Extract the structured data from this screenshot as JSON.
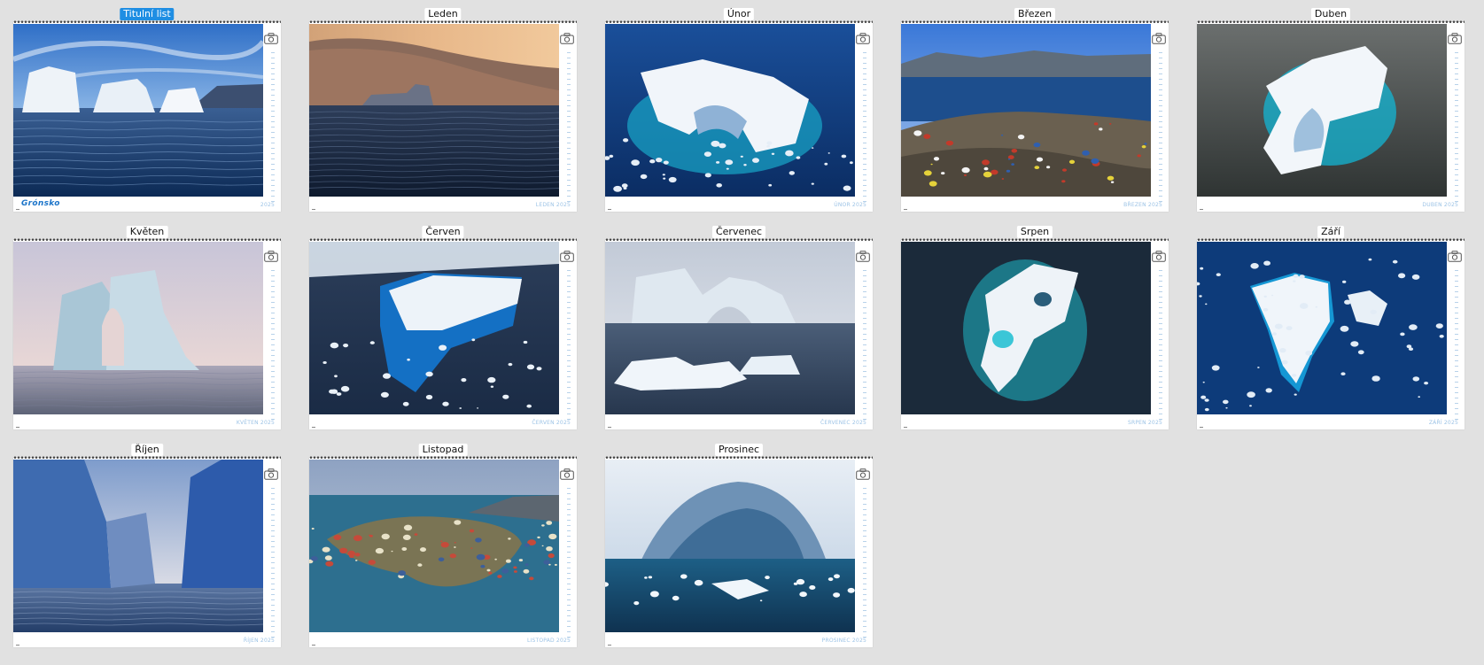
{
  "colors": {
    "background": "#e1e1e1",
    "selected_tag": "#1f8ee3",
    "footer_text": "#9cc3e6",
    "cover_title": "#1b74c9"
  },
  "pages": [
    {
      "label": "Titulní list",
      "footer": "2025",
      "cover_title": "Grónsko",
      "selected": true,
      "scene": "icebergs-sunny",
      "icon": "camera-icon"
    },
    {
      "label": "Leden",
      "footer": "LEDEN 2025",
      "selected": false,
      "scene": "dusk-sea",
      "icon": "camera-icon"
    },
    {
      "label": "Únor",
      "footer": "ÚNOR 2025",
      "selected": false,
      "scene": "aerial-arch",
      "icon": "camera-icon"
    },
    {
      "label": "Březen",
      "footer": "BŘEZEN 2025",
      "selected": false,
      "scene": "village-fjord",
      "icon": "camera-icon"
    },
    {
      "label": "Duben",
      "footer": "DUBEN 2025",
      "selected": false,
      "scene": "aerial-dark",
      "icon": "camera-icon"
    },
    {
      "label": "Květen",
      "footer": "KVĚTEN 2025",
      "selected": false,
      "scene": "arch-pastel",
      "icon": "camera-icon"
    },
    {
      "label": "Červen",
      "footer": "ČERVEN 2025",
      "selected": false,
      "scene": "floes-blue",
      "icon": "camera-icon"
    },
    {
      "label": "Červenec",
      "footer": "ČERVENEC 2025",
      "selected": false,
      "scene": "arch-grey",
      "icon": "camera-icon"
    },
    {
      "label": "Srpen",
      "footer": "SRPEN 2025",
      "selected": false,
      "scene": "aerial-night",
      "icon": "camera-icon"
    },
    {
      "label": "Září",
      "footer": "ZÁŘÍ 2025",
      "selected": false,
      "scene": "aerial-floes",
      "icon": "camera-icon"
    },
    {
      "label": "Říjen",
      "footer": "ŘÍJEN 2025",
      "selected": false,
      "scene": "walls-blue",
      "icon": "camera-icon"
    },
    {
      "label": "Listopad",
      "footer": "LISTOPAD 2025",
      "selected": false,
      "scene": "town-aerial",
      "icon": "camera-icon"
    },
    {
      "label": "Prosinec",
      "footer": "PROSINEC 2025",
      "selected": false,
      "scene": "ice-cave",
      "icon": "camera-icon"
    }
  ]
}
